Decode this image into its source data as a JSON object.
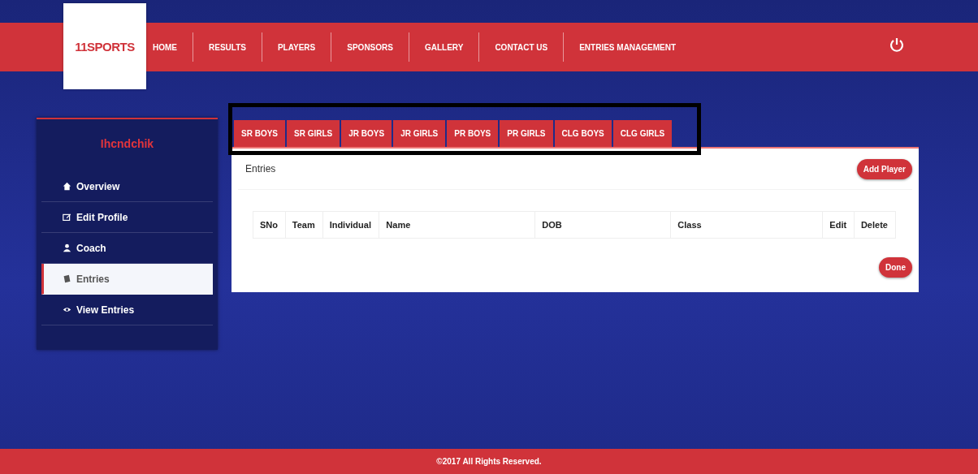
{
  "header": {
    "logo": "11SPORTS",
    "nav": [
      {
        "label": "HOME"
      },
      {
        "label": "RESULTS"
      },
      {
        "label": "PLAYERS"
      },
      {
        "label": "SPONSORS"
      },
      {
        "label": "GALLERY"
      },
      {
        "label": "CONTACT US"
      },
      {
        "label": "ENTRIES MANAGEMENT"
      }
    ]
  },
  "sidebar": {
    "username": "Ihcndchik",
    "items": [
      {
        "label": "Overview",
        "kind": "home",
        "selected": false
      },
      {
        "label": "Edit Profile",
        "kind": "edit",
        "selected": false
      },
      {
        "label": "Coach",
        "kind": "user",
        "selected": false
      },
      {
        "label": "Entries",
        "kind": "book",
        "selected": true
      },
      {
        "label": "View Entries",
        "kind": "eye",
        "selected": false
      }
    ]
  },
  "tabs": [
    {
      "label": "SR BOYS"
    },
    {
      "label": "SR GIRLS"
    },
    {
      "label": "JR BOYS"
    },
    {
      "label": "JR GIRLS"
    },
    {
      "label": "PR BOYS"
    },
    {
      "label": "PR GIRLS"
    },
    {
      "label": "CLG BOYS"
    },
    {
      "label": "CLG GIRLS"
    }
  ],
  "panel": {
    "title": "Entries",
    "add_button": "Add Player",
    "table": {
      "columns": [
        "SNo",
        "Team",
        "Individual",
        "Name",
        "DOB",
        "Class",
        "Edit",
        "Delete"
      ]
    },
    "done_button": "Done"
  },
  "footer": "©2017 All Rights Reserved."
}
